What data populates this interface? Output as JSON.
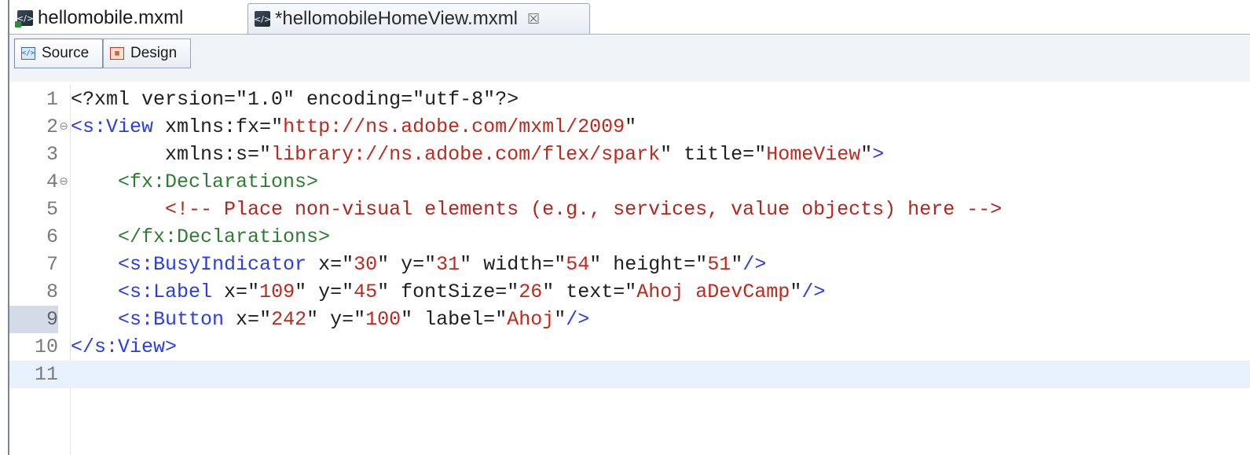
{
  "tabs": [
    {
      "label": "hellomobile.mxml",
      "icon": "mxml-app-file-icon",
      "active": false,
      "dirty": false
    },
    {
      "label": "*hellomobileHomeView.mxml",
      "icon": "mxml-file-icon",
      "active": true,
      "dirty": true,
      "close_glyph": "☒"
    }
  ],
  "toolbar": {
    "source_label": "Source",
    "design_label": "Design",
    "source_icon_glyph": "</>",
    "selected": "Source"
  },
  "editor": {
    "current_line": 9,
    "lines": [
      {
        "n": "1",
        "fold": "",
        "tokens": [
          {
            "c": "plain",
            "t": "<?xml version=\"1.0\" encoding=\"utf-8\"?>"
          }
        ]
      },
      {
        "n": "2",
        "fold": "⊖",
        "tokens": [
          {
            "c": "tag",
            "t": "<s:View"
          },
          {
            "c": "attr",
            "t": " xmlns:fx="
          },
          {
            "c": "plain",
            "t": "\""
          },
          {
            "c": "str",
            "t": "http://ns.adobe.com/mxml/2009"
          },
          {
            "c": "plain",
            "t": "\""
          }
        ]
      },
      {
        "n": "3",
        "fold": "",
        "tokens": [
          {
            "c": "attr",
            "t": "        xmlns:s="
          },
          {
            "c": "plain",
            "t": "\""
          },
          {
            "c": "str",
            "t": "library://ns.adobe.com/flex/spark"
          },
          {
            "c": "plain",
            "t": "\""
          },
          {
            "c": "attr",
            "t": " title="
          },
          {
            "c": "plain",
            "t": "\""
          },
          {
            "c": "str",
            "t": "HomeView"
          },
          {
            "c": "plain",
            "t": "\""
          },
          {
            "c": "tag",
            "t": ">"
          }
        ]
      },
      {
        "n": "4",
        "fold": "⊖",
        "tokens": [
          {
            "c": "plain",
            "t": "    "
          },
          {
            "c": "decl",
            "t": "<fx:Declarations>"
          }
        ]
      },
      {
        "n": "5",
        "fold": "",
        "tokens": [
          {
            "c": "plain",
            "t": "        "
          },
          {
            "c": "comment",
            "t": "<!-- Place non-visual elements (e.g., services, value objects) here -->"
          }
        ]
      },
      {
        "n": "6",
        "fold": "",
        "tokens": [
          {
            "c": "plain",
            "t": "    "
          },
          {
            "c": "decl",
            "t": "</fx:Declarations>"
          }
        ]
      },
      {
        "n": "7",
        "fold": "",
        "tokens": [
          {
            "c": "plain",
            "t": "    "
          },
          {
            "c": "tag",
            "t": "<s:BusyIndicator"
          },
          {
            "c": "attr",
            "t": " x="
          },
          {
            "c": "plain",
            "t": "\""
          },
          {
            "c": "str",
            "t": "30"
          },
          {
            "c": "plain",
            "t": "\""
          },
          {
            "c": "attr",
            "t": " y="
          },
          {
            "c": "plain",
            "t": "\""
          },
          {
            "c": "str",
            "t": "31"
          },
          {
            "c": "plain",
            "t": "\""
          },
          {
            "c": "attr",
            "t": " width="
          },
          {
            "c": "plain",
            "t": "\""
          },
          {
            "c": "str",
            "t": "54"
          },
          {
            "c": "plain",
            "t": "\""
          },
          {
            "c": "attr",
            "t": " height="
          },
          {
            "c": "plain",
            "t": "\""
          },
          {
            "c": "str",
            "t": "51"
          },
          {
            "c": "plain",
            "t": "\""
          },
          {
            "c": "tag",
            "t": "/>"
          }
        ]
      },
      {
        "n": "8",
        "fold": "",
        "tokens": [
          {
            "c": "plain",
            "t": "    "
          },
          {
            "c": "tag",
            "t": "<s:Label"
          },
          {
            "c": "attr",
            "t": " x="
          },
          {
            "c": "plain",
            "t": "\""
          },
          {
            "c": "str",
            "t": "109"
          },
          {
            "c": "plain",
            "t": "\""
          },
          {
            "c": "attr",
            "t": " y="
          },
          {
            "c": "plain",
            "t": "\""
          },
          {
            "c": "str",
            "t": "45"
          },
          {
            "c": "plain",
            "t": "\""
          },
          {
            "c": "attr",
            "t": " fontSize="
          },
          {
            "c": "plain",
            "t": "\""
          },
          {
            "c": "str",
            "t": "26"
          },
          {
            "c": "plain",
            "t": "\""
          },
          {
            "c": "attr",
            "t": " text="
          },
          {
            "c": "plain",
            "t": "\""
          },
          {
            "c": "str",
            "t": "Ahoj aDevCamp"
          },
          {
            "c": "plain",
            "t": "\""
          },
          {
            "c": "tag",
            "t": "/>"
          }
        ]
      },
      {
        "n": "9",
        "fold": "",
        "tokens": [
          {
            "c": "plain",
            "t": "    "
          },
          {
            "c": "tag",
            "t": "<s:Button"
          },
          {
            "c": "attr",
            "t": " x="
          },
          {
            "c": "plain",
            "t": "\""
          },
          {
            "c": "str",
            "t": "242"
          },
          {
            "c": "plain",
            "t": "\""
          },
          {
            "c": "attr",
            "t": " y="
          },
          {
            "c": "plain",
            "t": "\""
          },
          {
            "c": "str",
            "t": "100"
          },
          {
            "c": "plain",
            "t": "\""
          },
          {
            "c": "attr",
            "t": " label="
          },
          {
            "c": "plain",
            "t": "\""
          },
          {
            "c": "str",
            "t": "Ahoj"
          },
          {
            "c": "plain",
            "t": "\""
          },
          {
            "c": "tag",
            "t": "/>"
          }
        ]
      },
      {
        "n": "10",
        "fold": "",
        "tokens": [
          {
            "c": "tag",
            "t": "</s:View>"
          }
        ]
      },
      {
        "n": "11",
        "fold": "",
        "tokens": []
      }
    ]
  },
  "colors": {
    "tag": "#2a3de8",
    "declaration": "#2e7d32",
    "string": "#c0281c",
    "comment": "#b3261e",
    "current_line_bg": "#e8f2fe"
  }
}
